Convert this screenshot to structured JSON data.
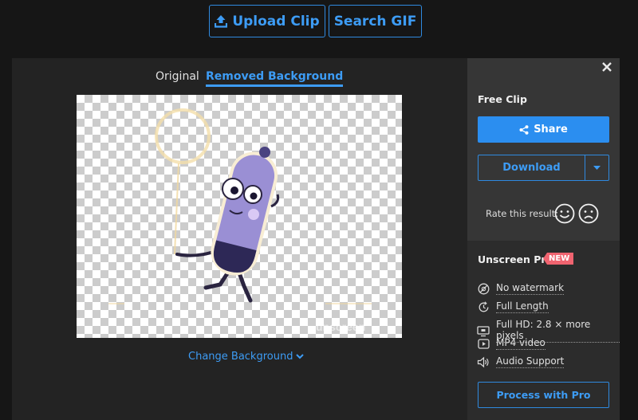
{
  "header": {
    "upload_label": "Upload Clip",
    "search_label": "Search GIF"
  },
  "preview": {
    "tabs": [
      {
        "label": "Original",
        "active": false
      },
      {
        "label": "Removed Background",
        "active": true
      }
    ],
    "change_background_label": "Change Background",
    "watermark_text": "unscreen"
  },
  "sidebar": {
    "free_clip_title": "Free Clip",
    "share_label": "Share",
    "download_label": "Download",
    "rate_label": "Rate this result:",
    "pro": {
      "title": "Unscreen Pro",
      "badge": "NEW",
      "features": [
        {
          "icon": "no-watermark-icon",
          "label": "No watermark"
        },
        {
          "icon": "full-length-icon",
          "label": "Full Length"
        },
        {
          "icon": "hd-icon",
          "label": "Full HD: 2.8 × more pixels"
        },
        {
          "icon": "video-icon",
          "label": "MP4 video"
        },
        {
          "icon": "audio-icon",
          "label": "Audio Support"
        }
      ],
      "process_label": "Process with Pro"
    }
  },
  "colors": {
    "accent": "#2b8ef0",
    "background": "#161616",
    "panel": "#232323",
    "sidebar": "#363636",
    "badge": "#f06470"
  }
}
